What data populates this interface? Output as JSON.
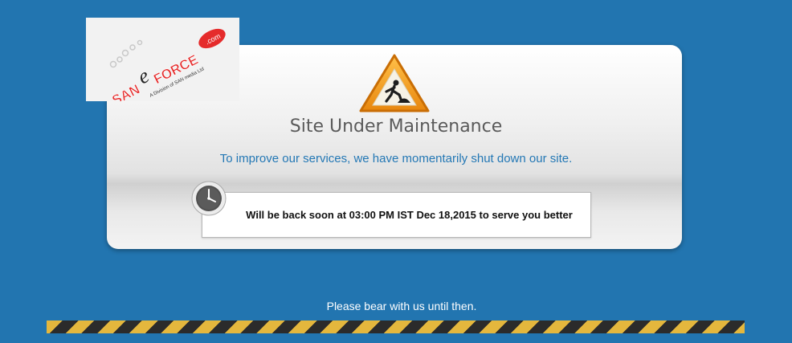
{
  "logo": {
    "brand_san": "SAN",
    "brand_e": "e",
    "brand_force": "FORCE",
    "brand_com": ".com",
    "tagline": "A Division of SAN media Ltd"
  },
  "main": {
    "title": "Site Under Maintenance",
    "subtitle": "To improve our services, we have momentarily shut down our site.",
    "notice": "Will be back soon at 03:00 PM IST Dec 18,2015 to serve you better"
  },
  "footer": {
    "message": "Please bear with us until then."
  },
  "icons": {
    "warning": "under-construction-warning-icon",
    "clock": "clock-icon"
  },
  "colors": {
    "background": "#2275b0",
    "accent": "#2478b5",
    "brand_red": "#e52b2b",
    "warning_orange": "#f3a51d",
    "hazard_yellow": "#e4b73d"
  }
}
